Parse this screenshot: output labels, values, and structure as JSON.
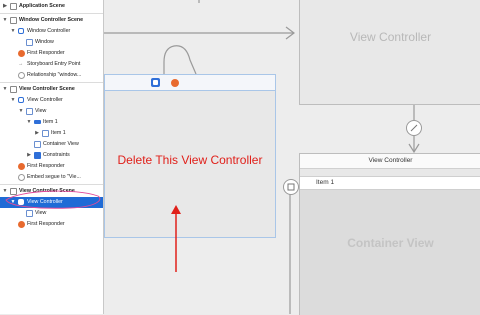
{
  "outline": {
    "rows": [
      {
        "label": "Application Scene",
        "kind": "scene"
      },
      {
        "label": "Window Controller Scene",
        "kind": "scene"
      },
      {
        "label": "Window Controller"
      },
      {
        "label": "Window"
      },
      {
        "label": "First Responder"
      },
      {
        "label": "Storyboard Entry Point"
      },
      {
        "label": "Relationship \"window..."
      },
      {
        "label": "View Controller Scene",
        "kind": "scene"
      },
      {
        "label": "View Controller"
      },
      {
        "label": "View"
      },
      {
        "label": "Item 1"
      },
      {
        "label": "Item 1"
      },
      {
        "label": "Container View"
      },
      {
        "label": "Constraints"
      },
      {
        "label": "First Responder"
      },
      {
        "label": "Embed segue to \"Vie..."
      },
      {
        "label": "View Controller Scene",
        "kind": "scene"
      },
      {
        "label": "View Controller"
      },
      {
        "label": "View"
      },
      {
        "label": "First Responder"
      }
    ]
  },
  "canvas": {
    "top_right_title": "View Controller",
    "annotation": "Delete This View Controller",
    "embedded": {
      "header": "View Controller",
      "item_label": "Item 1",
      "container_label": "Container View"
    }
  },
  "colors": {
    "annotation": "#e0201a",
    "selection": "#1f6bd6",
    "selection_border": "#a9c6e8"
  }
}
